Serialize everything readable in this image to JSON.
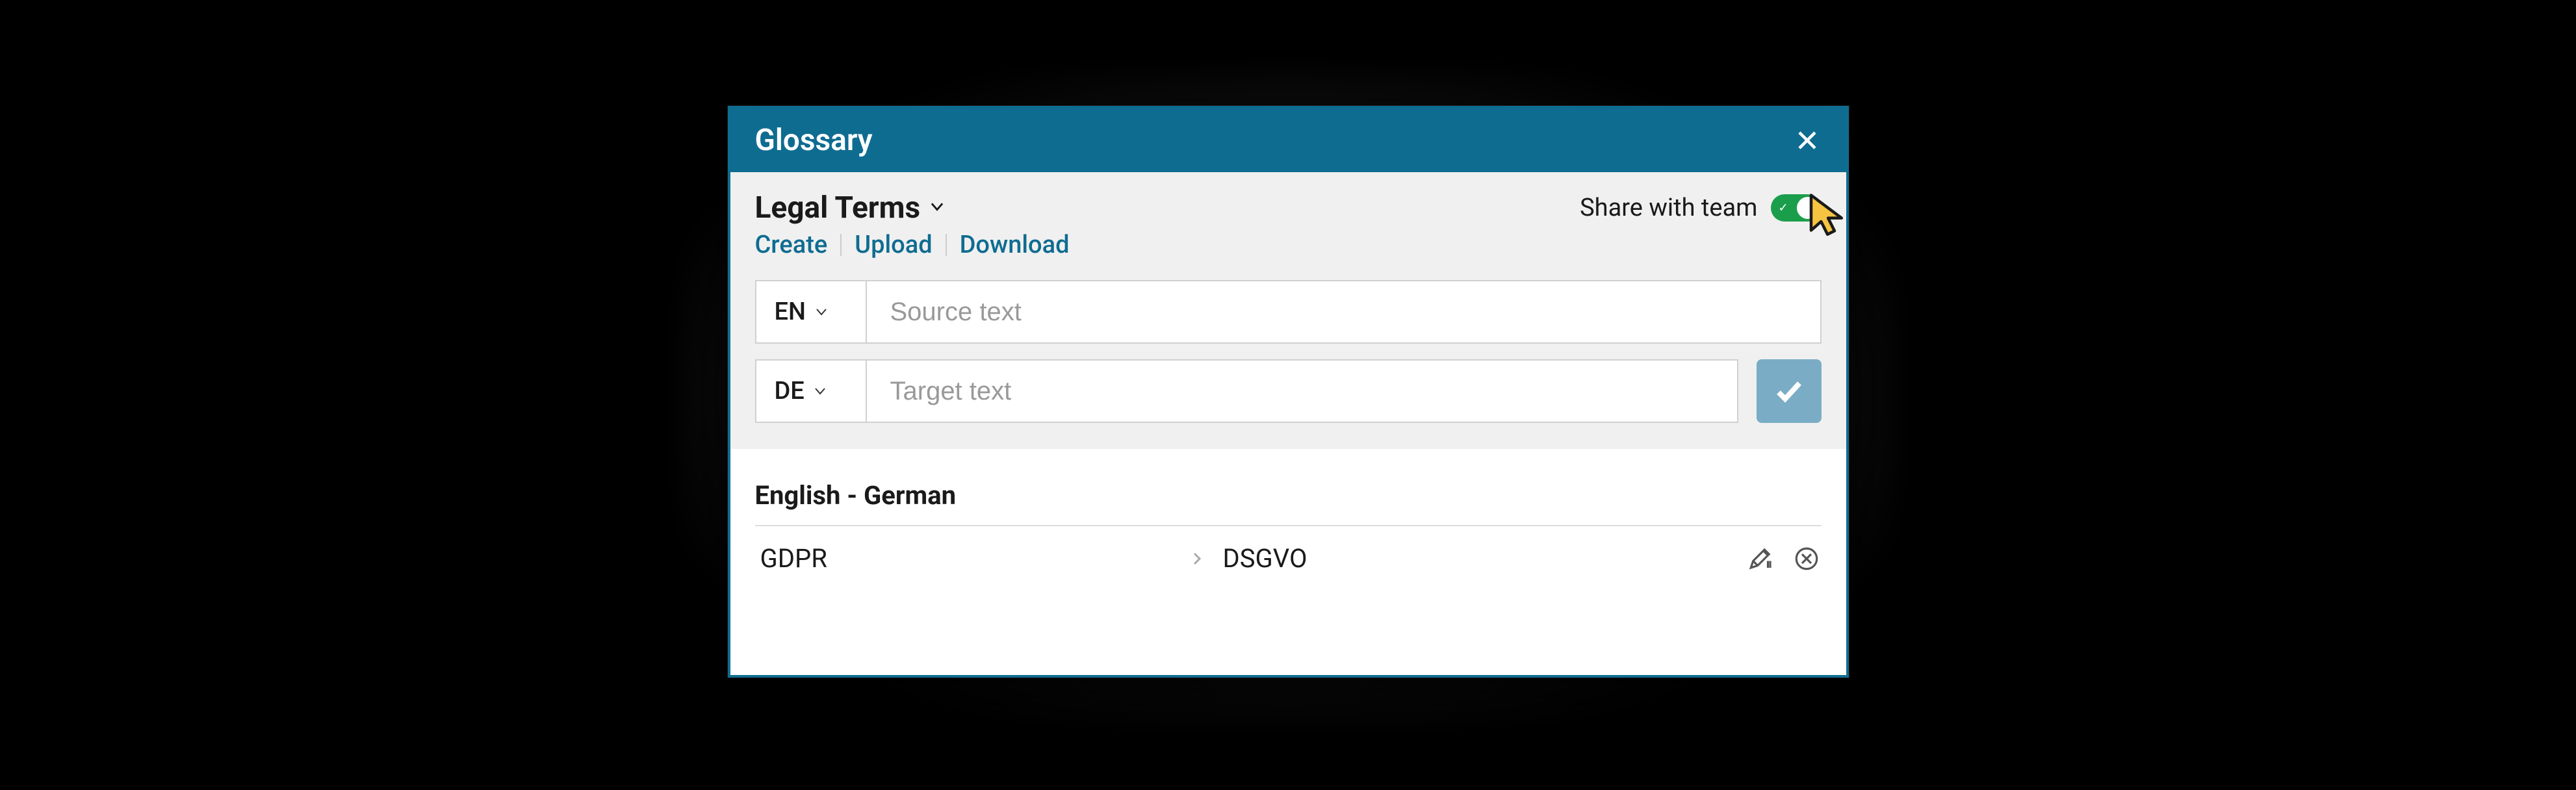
{
  "header": {
    "title": "Glossary"
  },
  "controls": {
    "glossary_name": "Legal Terms",
    "share_label": "Share with team",
    "share_enabled": true,
    "actions": {
      "create": "Create",
      "upload": "Upload",
      "download": "Download"
    },
    "source_lang": "EN",
    "target_lang": "DE",
    "source_placeholder": "Source text",
    "target_placeholder": "Target text"
  },
  "entries": {
    "pair_label": "English  -  German",
    "items": [
      {
        "source": "GDPR",
        "target": "DSGVO"
      }
    ]
  }
}
